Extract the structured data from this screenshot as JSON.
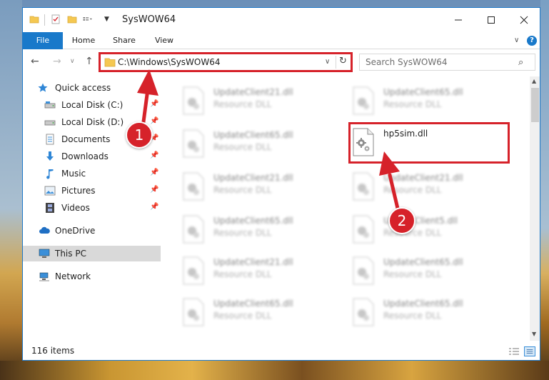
{
  "window": {
    "title": "SysWOW64"
  },
  "ribbon": {
    "tabs": [
      "File",
      "Home",
      "Share",
      "View"
    ]
  },
  "navigation": {
    "address": "C:\\Windows\\SysWOW64",
    "search_placeholder": "Search SysWOW64"
  },
  "sidebar": {
    "items": [
      {
        "label": "Quick access",
        "icon": "star-icon",
        "pinned": false
      },
      {
        "label": "Local Disk (C:)",
        "icon": "drive-icon",
        "pinned": true
      },
      {
        "label": "Local Disk (D:)",
        "icon": "drive-icon",
        "pinned": true
      },
      {
        "label": "Documents",
        "icon": "documents-icon",
        "pinned": true
      },
      {
        "label": "Downloads",
        "icon": "download-arrow-icon",
        "pinned": true
      },
      {
        "label": "Music",
        "icon": "music-note-icon",
        "pinned": true
      },
      {
        "label": "Pictures",
        "icon": "pictures-icon",
        "pinned": true
      },
      {
        "label": "Videos",
        "icon": "film-icon",
        "pinned": true
      },
      {
        "label": "OneDrive",
        "icon": "cloud-icon",
        "pinned": false
      },
      {
        "label": "This PC",
        "icon": "monitor-icon",
        "pinned": false,
        "selected": true
      },
      {
        "label": "Network",
        "icon": "network-icon",
        "pinned": false
      }
    ]
  },
  "files": [
    {
      "name": "UpdateClient21.dll",
      "type": "Resource DLL",
      "blurred": true
    },
    {
      "name": "UpdateClient65.dll",
      "type": "Resource DLL",
      "blurred": true
    },
    {
      "name": "UpdateClient65.dll",
      "type": "Resource DLL",
      "blurred": true
    },
    {
      "name": "hp5sim.dll",
      "type": "",
      "blurred": false,
      "highlighted": true
    },
    {
      "name": "UpdateClient21.dll",
      "type": "Resource DLL",
      "blurred": true
    },
    {
      "name": "UpdateClient21.dll",
      "type": "Resource DLL",
      "blurred": true
    },
    {
      "name": "UpdateClient65.dll",
      "type": "Resource DLL",
      "blurred": true
    },
    {
      "name": "UpdateClient5.dll",
      "type": "Resource DLL",
      "blurred": true
    },
    {
      "name": "UpdateClient21.dll",
      "type": "Resource DLL",
      "blurred": true
    },
    {
      "name": "UpdateClient65.dll",
      "type": "Resource DLL",
      "blurred": true
    },
    {
      "name": "UpdateClient65.dll",
      "type": "Resource DLL",
      "blurred": true
    },
    {
      "name": "UpdateClient65.dll",
      "type": "Resource DLL",
      "blurred": true
    },
    {
      "name": "UpdateClient21.dll",
      "type": "Resource DLL",
      "blurred": true
    },
    {
      "name": "UpdateClient65.dll",
      "type": "Resource DLL",
      "blurred": true
    }
  ],
  "status": {
    "item_count": "116 items"
  },
  "callouts": [
    "1",
    "2"
  ],
  "colors": {
    "accent": "#1979ca",
    "highlight_red": "#d6222a",
    "selected_bg": "#d9d9d9"
  }
}
